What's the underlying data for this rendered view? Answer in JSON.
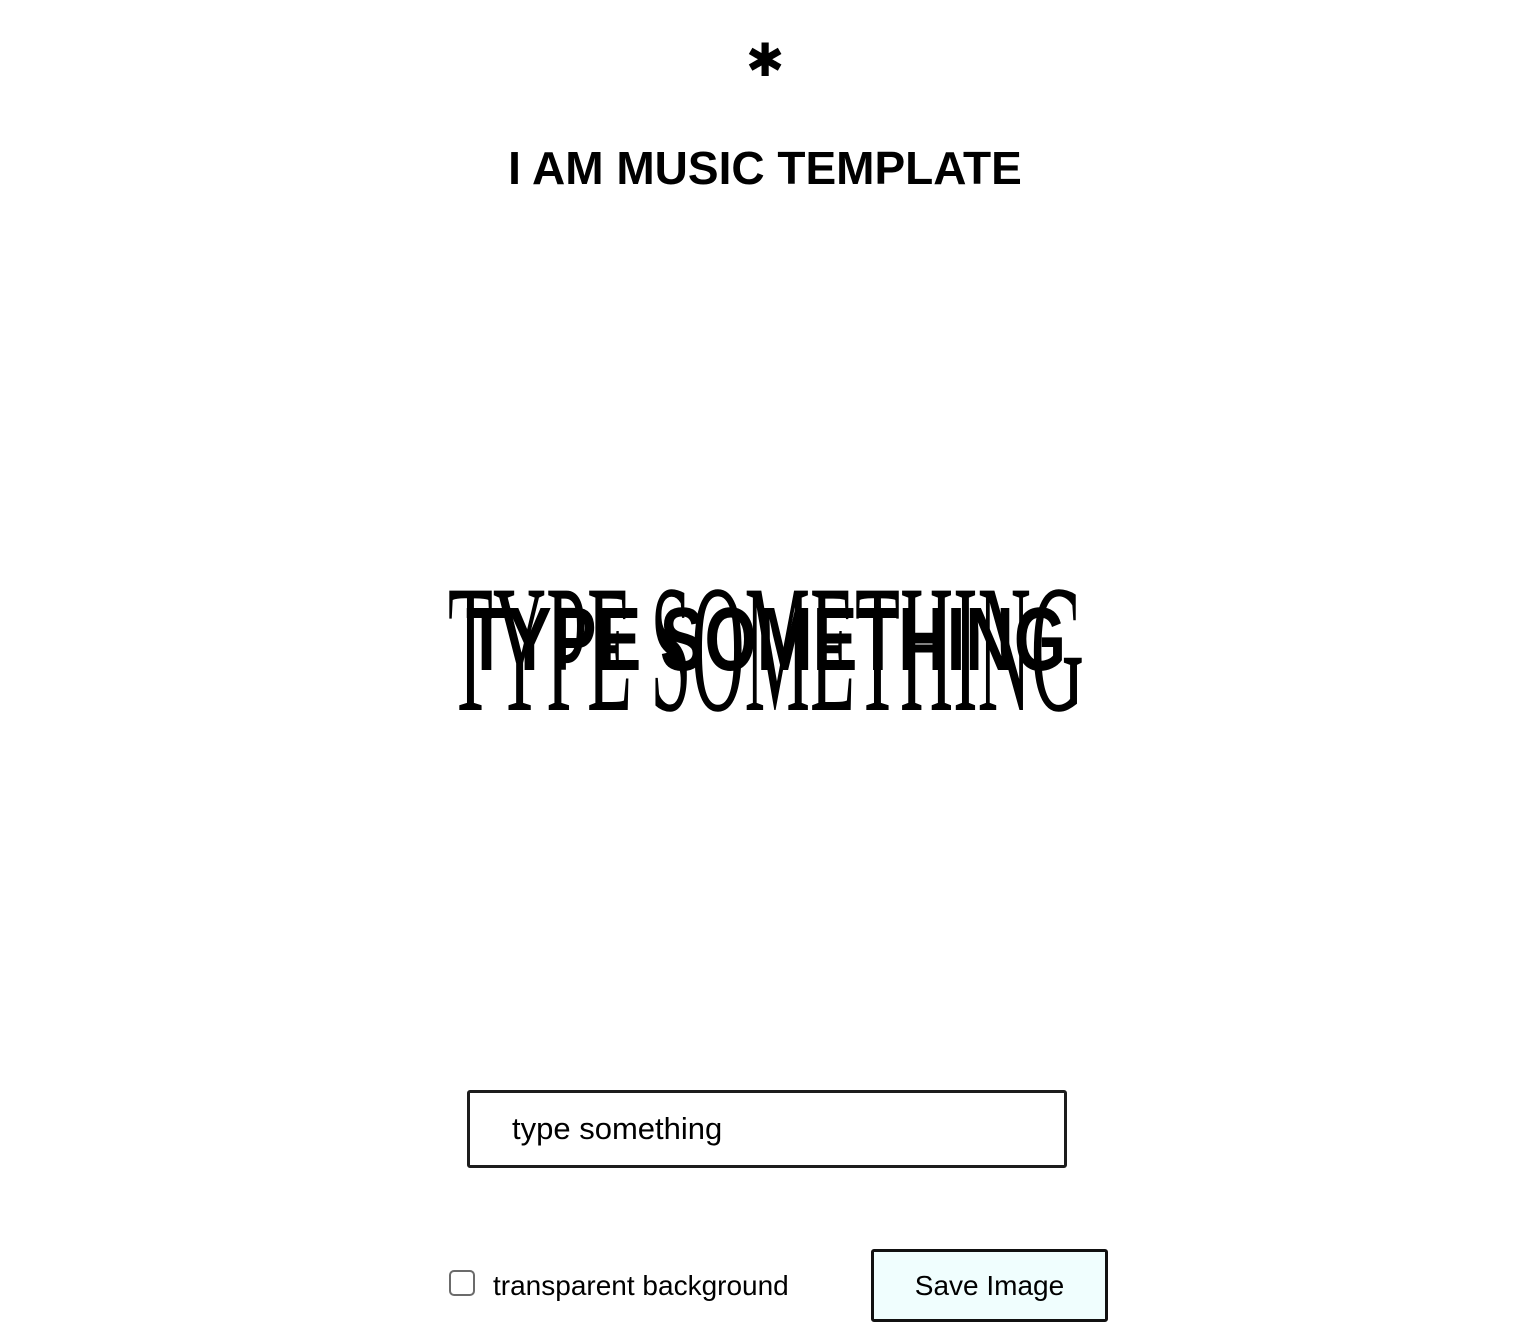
{
  "header": {
    "logo_glyph": "✱",
    "title": "I AM MUSIC TEMPLATE"
  },
  "preview": {
    "back_text": "TYPE SOMETHING",
    "front_text": "TYPE SOMETHING",
    "text_color": "#000000"
  },
  "editor": {
    "input_value": "type something"
  },
  "controls": {
    "transparent_label": "transparent background",
    "transparent_checked": false,
    "save_label": "Save Image",
    "save_button_bg": "#f0fefe"
  }
}
